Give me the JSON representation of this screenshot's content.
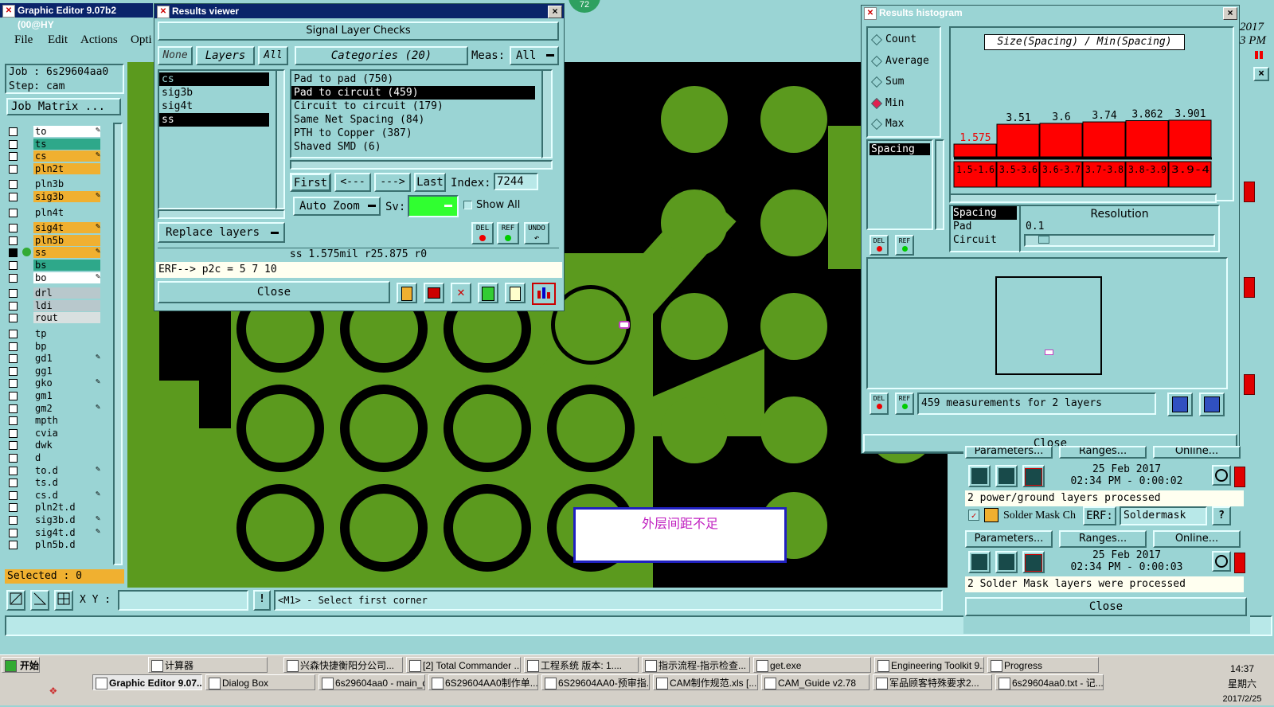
{
  "main": {
    "title": "Graphic Editor 9.07b2 (00@HY",
    "menus": [
      "File",
      "Edit",
      "Actions",
      "Opti"
    ],
    "job": "Job : 6s29604aa0",
    "step": "Step: cam",
    "job_matrix": "Job Matrix ...",
    "selected": "Selected : 0",
    "xy_label": "X Y :",
    "status_msg": "<M1> - Select first corner",
    "badge": "72",
    "popup_text": "外层间距不足",
    "right_year": "2017",
    "right_pm": "3 PM"
  },
  "layers": [
    {
      "name": "to",
      "color": "#ffffff",
      "edit": true
    },
    {
      "name": "ts",
      "color": "#2ea88a",
      "edit": false
    },
    {
      "name": "cs",
      "color": "#f0b030",
      "edit": true
    },
    {
      "name": "pln2t",
      "color": "#f0b030",
      "edit": false
    },
    {
      "name": "pln3b",
      "color": "#9ad4d4",
      "edit": false
    },
    {
      "name": "sig3b",
      "color": "#f0b030",
      "edit": true
    },
    {
      "name": "pln4t",
      "color": "#9ad4d4",
      "edit": false
    },
    {
      "name": "sig4t",
      "color": "#f0b030",
      "edit": true
    },
    {
      "name": "pln5b",
      "color": "#f0b030",
      "edit": false
    },
    {
      "name": "ss",
      "color": "#f0b030",
      "edit": true
    },
    {
      "name": "bs",
      "color": "#2ea88a",
      "edit": false
    },
    {
      "name": "bo",
      "color": "#ffffff",
      "edit": true
    },
    {
      "name": "drl",
      "color": "#b8c8cc",
      "edit": false
    },
    {
      "name": "ldi",
      "color": "#b8c8cc",
      "edit": false
    },
    {
      "name": "rout",
      "color": "#d8e0e0",
      "edit": false
    },
    {
      "name": "tp",
      "color": "#9ad4d4",
      "edit": false
    },
    {
      "name": "bp",
      "color": "#9ad4d4",
      "edit": false
    },
    {
      "name": "gd1",
      "color": "#9ad4d4",
      "edit": true
    },
    {
      "name": "gg1",
      "color": "#9ad4d4",
      "edit": false
    },
    {
      "name": "gko",
      "color": "#9ad4d4",
      "edit": true
    },
    {
      "name": "gm1",
      "color": "#9ad4d4",
      "edit": false
    },
    {
      "name": "gm2",
      "color": "#9ad4d4",
      "edit": true
    },
    {
      "name": "mpth",
      "color": "#9ad4d4",
      "edit": false
    },
    {
      "name": "cvia",
      "color": "#9ad4d4",
      "edit": false
    },
    {
      "name": "dwk",
      "color": "#9ad4d4",
      "edit": false
    },
    {
      "name": "d",
      "color": "#9ad4d4",
      "edit": false
    },
    {
      "name": "to.d",
      "color": "#9ad4d4",
      "edit": true
    },
    {
      "name": "ts.d",
      "color": "#9ad4d4",
      "edit": false
    },
    {
      "name": "cs.d",
      "color": "#9ad4d4",
      "edit": true
    },
    {
      "name": "pln2t.d",
      "color": "#9ad4d4",
      "edit": false
    },
    {
      "name": "sig3b.d",
      "color": "#9ad4d4",
      "edit": true
    },
    {
      "name": "sig4t.d",
      "color": "#9ad4d4",
      "edit": true
    },
    {
      "name": "pln5b.d",
      "color": "#9ad4d4",
      "edit": false
    }
  ],
  "results_viewer": {
    "title": "Results viewer",
    "header": "Signal Layer Checks",
    "none_btn": "None",
    "layers_btn": "Layers",
    "all_btn": "All",
    "categories_btn": "Categories (20)",
    "meas_label": "Meas:",
    "meas_value": "All",
    "layers_list": [
      "cs",
      "sig3b",
      "sig4t",
      "ss"
    ],
    "categories": [
      "Pad to pad (750)",
      "Pad to circuit (459)",
      "Circuit to circuit (179)",
      "Same Net Spacing (84)",
      "PTH to Copper (387)",
      "Shaved SMD (6)"
    ],
    "first": "First",
    "prev": "<---",
    "next": "--->",
    "last": "Last",
    "index_label": "Index:",
    "index_value": "7244",
    "auto_zoom": "Auto Zoom",
    "sv_label": "Sv:",
    "show_all": "Show All",
    "replace_layers": "Replace layers",
    "del": "DEL",
    "ref": "REF",
    "undo": "UNDO",
    "measure_line": "ss 1.575mil   r25.875   r0",
    "erf_line": "ERF--> p2c = 5 7 10",
    "close": "Close"
  },
  "histogram": {
    "title": "Results histogram",
    "options": [
      "Count",
      "Average",
      "Sum",
      "Min",
      "Max"
    ],
    "selected_option": "Min",
    "chart_title": "Size(Spacing) / Min(Spacing)",
    "attr_list": [
      "Spacing"
    ],
    "resolution_label": "Resolution",
    "resolution_value": "0.1",
    "res_list": [
      "Spacing",
      "Pad",
      "Circuit"
    ],
    "measurements": "459 measurements for 2 layers",
    "close": "Close",
    "del": "DEL",
    "ref": "REF"
  },
  "chart_data": {
    "type": "bar",
    "title": "Size(Spacing) / Min(Spacing)",
    "categories": [
      "1.5-1.6",
      "3.5-3.6",
      "3.6-3.7",
      "3.7-3.8",
      "3.8-3.9",
      "3.9-4"
    ],
    "values": [
      1.575,
      3.51,
      3.6,
      3.74,
      3.862,
      3.901
    ],
    "labels": [
      "1.575",
      "3.51",
      "3.6",
      "3.74",
      "3.862",
      "3.901"
    ],
    "ylim": [
      0,
      4
    ],
    "grid": false
  },
  "right_panel": {
    "params": "Parameters...",
    "ranges": "Ranges...",
    "online": "Online...",
    "date1": "25 Feb 2017",
    "time1": "02:34 PM - 0:00:02",
    "status1": "2 power/ground layers processed",
    "solder_mask": "Solder Mask Ch",
    "erf_label": "ERF:",
    "erf_value": "Soldermask",
    "help": "?",
    "date2": "25 Feb 2017",
    "time2": "02:34 PM - 0:00:03",
    "status2": "2 Solder Mask layers were processed",
    "close": "Close"
  },
  "taskbar": {
    "start": "开始",
    "row1": [
      "计算器",
      "兴森快捷衡阳分公司...",
      "[2] Total Commander ...",
      "工程系统  版本: 1....",
      "指示流程-指示检查...",
      "get.exe",
      "Engineering Toolkit 9....",
      "Progress"
    ],
    "row2": [
      "Graphic Editor 9.07...",
      "Dialog Box",
      "6s29604aa0 - main_qa",
      "6S29604AA0制作单....",
      "6S29604AA0-预审指...",
      "CAM制作规范.xls [...",
      "CAM_Guide v2.78",
      "军品顾客特殊要求2...",
      "6s29604aa0.txt - 记..."
    ],
    "time": "14:37",
    "weekday": "星期六",
    "date": "2017/2/25"
  }
}
